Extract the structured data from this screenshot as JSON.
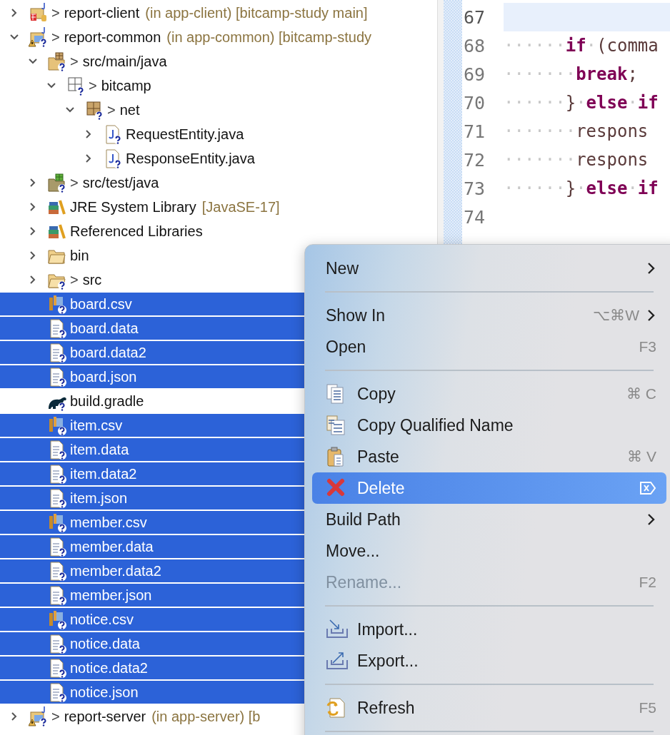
{
  "explorer": {
    "nodes": [
      {
        "kind": "project",
        "prefix": ">",
        "label": "report-client",
        "decoration": "(in app-client) [bitcamp-study main]",
        "expanded": false,
        "selected": false
      },
      {
        "kind": "project-warning",
        "prefix": ">",
        "label": "report-common",
        "decoration": "(in app-common) [bitcamp-study",
        "expanded": true,
        "selected": false,
        "children": [
          {
            "kind": "source-folder",
            "prefix": ">",
            "label": "src/main/java",
            "expanded": true,
            "selected": false,
            "children": [
              {
                "kind": "package-empty",
                "prefix": ">",
                "label": "bitcamp",
                "expanded": true,
                "selected": false,
                "children": [
                  {
                    "kind": "package",
                    "prefix": ">",
                    "label": "net",
                    "expanded": true,
                    "selected": false,
                    "children": [
                      {
                        "kind": "java-file",
                        "label": "RequestEntity.java",
                        "expanded": false,
                        "selected": false
                      },
                      {
                        "kind": "java-file",
                        "label": "ResponseEntity.java",
                        "expanded": false,
                        "selected": false
                      }
                    ]
                  }
                ]
              }
            ]
          },
          {
            "kind": "test-folder",
            "prefix": ">",
            "label": "src/test/java",
            "expanded": false,
            "selected": false
          },
          {
            "kind": "library",
            "label": "JRE System Library",
            "decoration": "[JavaSE-17]",
            "expanded": false,
            "selected": false
          },
          {
            "kind": "library",
            "label": "Referenced Libraries",
            "expanded": false,
            "selected": false
          },
          {
            "kind": "folder",
            "label": "bin",
            "expanded": false,
            "selected": false
          },
          {
            "kind": "folder-question",
            "prefix": ">",
            "label": "src",
            "expanded": false,
            "selected": false
          },
          {
            "kind": "csv-file",
            "label": "board.csv",
            "selected": true
          },
          {
            "kind": "text-file",
            "label": "board.data",
            "selected": true
          },
          {
            "kind": "text-file",
            "label": "board.data2",
            "selected": true
          },
          {
            "kind": "text-file",
            "label": "board.json",
            "selected": true
          },
          {
            "kind": "gradle-file",
            "label": "build.gradle",
            "selected": false
          },
          {
            "kind": "csv-file",
            "label": "item.csv",
            "selected": true
          },
          {
            "kind": "text-file",
            "label": "item.data",
            "selected": true
          },
          {
            "kind": "text-file",
            "label": "item.data2",
            "selected": true
          },
          {
            "kind": "text-file",
            "label": "item.json",
            "selected": true
          },
          {
            "kind": "csv-file",
            "label": "member.csv",
            "selected": true
          },
          {
            "kind": "text-file",
            "label": "member.data",
            "selected": true
          },
          {
            "kind": "text-file",
            "label": "member.data2",
            "selected": true
          },
          {
            "kind": "text-file",
            "label": "member.json",
            "selected": true
          },
          {
            "kind": "csv-file",
            "label": "notice.csv",
            "selected": true
          },
          {
            "kind": "text-file",
            "label": "notice.data",
            "selected": true
          },
          {
            "kind": "text-file",
            "label": "notice.data2",
            "selected": true
          },
          {
            "kind": "text-file",
            "label": "notice.json",
            "selected": true
          }
        ]
      },
      {
        "kind": "project-warning",
        "prefix": ">",
        "label": "report-server",
        "decoration": "(in app-server) [b",
        "expanded": false,
        "selected": false
      }
    ]
  },
  "editor": {
    "lines": [
      {
        "number": "67",
        "current": true
      },
      {
        "number": "68",
        "current": false,
        "tokens": [
          {
            "kind": "ws",
            "text": "······"
          },
          {
            "kind": "keyword",
            "text": "if"
          },
          {
            "kind": "ws",
            "text": "·"
          },
          {
            "kind": "plain",
            "text": "(comma"
          }
        ]
      },
      {
        "number": "69",
        "current": false,
        "tokens": [
          {
            "kind": "ws",
            "text": "·······"
          },
          {
            "kind": "keyword",
            "text": "break"
          },
          {
            "kind": "plain",
            "text": ";"
          }
        ]
      },
      {
        "number": "70",
        "current": false,
        "tokens": [
          {
            "kind": "ws",
            "text": "······"
          },
          {
            "kind": "plain",
            "text": "}"
          },
          {
            "kind": "ws",
            "text": "·"
          },
          {
            "kind": "keyword",
            "text": "else"
          },
          {
            "kind": "ws",
            "text": "·"
          },
          {
            "kind": "keyword",
            "text": "if"
          }
        ]
      },
      {
        "number": "71",
        "current": false,
        "tokens": [
          {
            "kind": "ws",
            "text": "·······"
          },
          {
            "kind": "plain",
            "text": "respons"
          }
        ]
      },
      {
        "number": "72",
        "current": false,
        "tokens": [
          {
            "kind": "ws",
            "text": "·······"
          },
          {
            "kind": "plain",
            "text": "respons"
          }
        ]
      },
      {
        "number": "73",
        "current": false,
        "tokens": [
          {
            "kind": "ws",
            "text": "······"
          },
          {
            "kind": "plain",
            "text": "}"
          },
          {
            "kind": "ws",
            "text": "·"
          },
          {
            "kind": "keyword",
            "text": "else"
          },
          {
            "kind": "ws",
            "text": "·"
          },
          {
            "kind": "keyword",
            "text": "if"
          }
        ]
      },
      {
        "number": "74",
        "current": false
      }
    ]
  },
  "context_menu": {
    "items": [
      {
        "kind": "item",
        "label": "New",
        "submenu": true,
        "selected": false,
        "disabled": false
      },
      {
        "kind": "separator"
      },
      {
        "kind": "item",
        "label": "Show In",
        "shortcut": "⌥⌘W",
        "submenu": true,
        "selected": false,
        "disabled": false
      },
      {
        "kind": "item",
        "label": "Open",
        "shortcut": "F3",
        "selected": false,
        "disabled": false
      },
      {
        "kind": "separator"
      },
      {
        "kind": "copy",
        "label": "Copy",
        "shortcut": "⌘ C",
        "selected": false,
        "disabled": false
      },
      {
        "kind": "copyname",
        "label": "Copy Qualified Name",
        "selected": false,
        "disabled": false
      },
      {
        "kind": "paste",
        "label": "Paste",
        "shortcut": "⌘ V",
        "selected": false,
        "disabled": false
      },
      {
        "kind": "delete",
        "label": "Delete",
        "selected": true,
        "disabled": false
      },
      {
        "kind": "item",
        "label": "Build Path",
        "submenu": true,
        "selected": false,
        "disabled": false
      },
      {
        "kind": "item",
        "label": "Move...",
        "selected": false,
        "disabled": false
      },
      {
        "kind": "item",
        "label": "Rename...",
        "shortcut": "F2",
        "selected": false,
        "disabled": true
      },
      {
        "kind": "separator"
      },
      {
        "kind": "import",
        "label": "Import...",
        "selected": false,
        "disabled": false
      },
      {
        "kind": "export",
        "label": "Export...",
        "selected": false,
        "disabled": false
      },
      {
        "kind": "separator"
      },
      {
        "kind": "refresh",
        "label": "Refresh",
        "shortcut": "F5",
        "selected": false,
        "disabled": false
      },
      {
        "kind": "separator"
      }
    ]
  }
}
